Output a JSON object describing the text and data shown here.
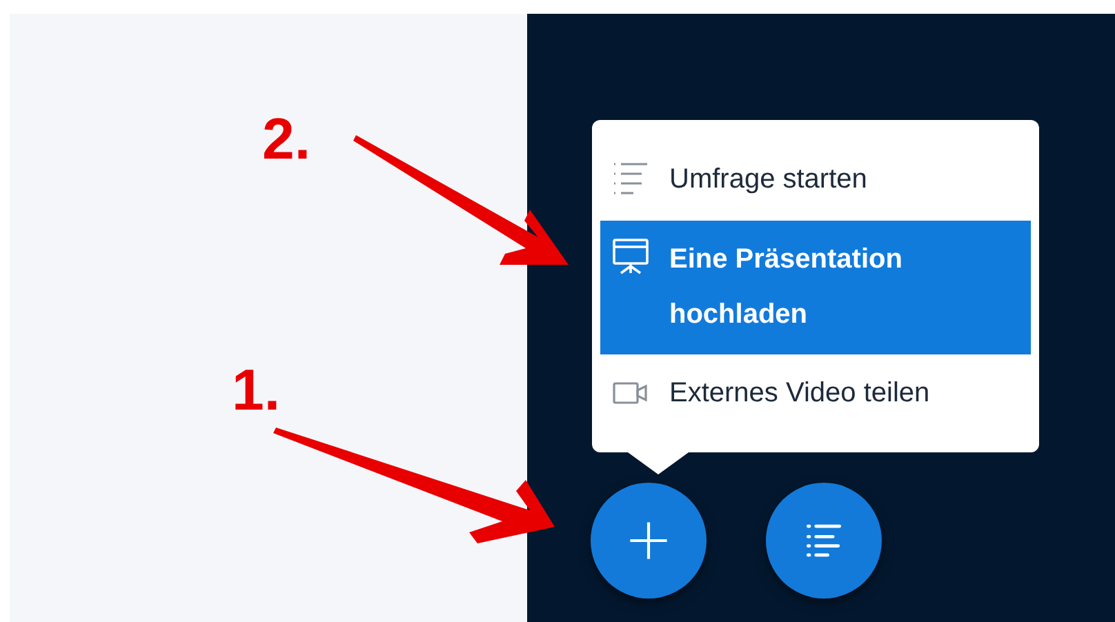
{
  "annotations": [
    {
      "label": "2."
    },
    {
      "label": "1."
    }
  ],
  "menu": {
    "items": [
      {
        "kind": "poll",
        "label": "Umfrage starten",
        "selected": false
      },
      {
        "kind": "presentation",
        "label": "Eine Präsentation hochladen",
        "selected": true
      },
      {
        "kind": "video",
        "label": "Externes Video teilen",
        "selected": false
      }
    ]
  }
}
